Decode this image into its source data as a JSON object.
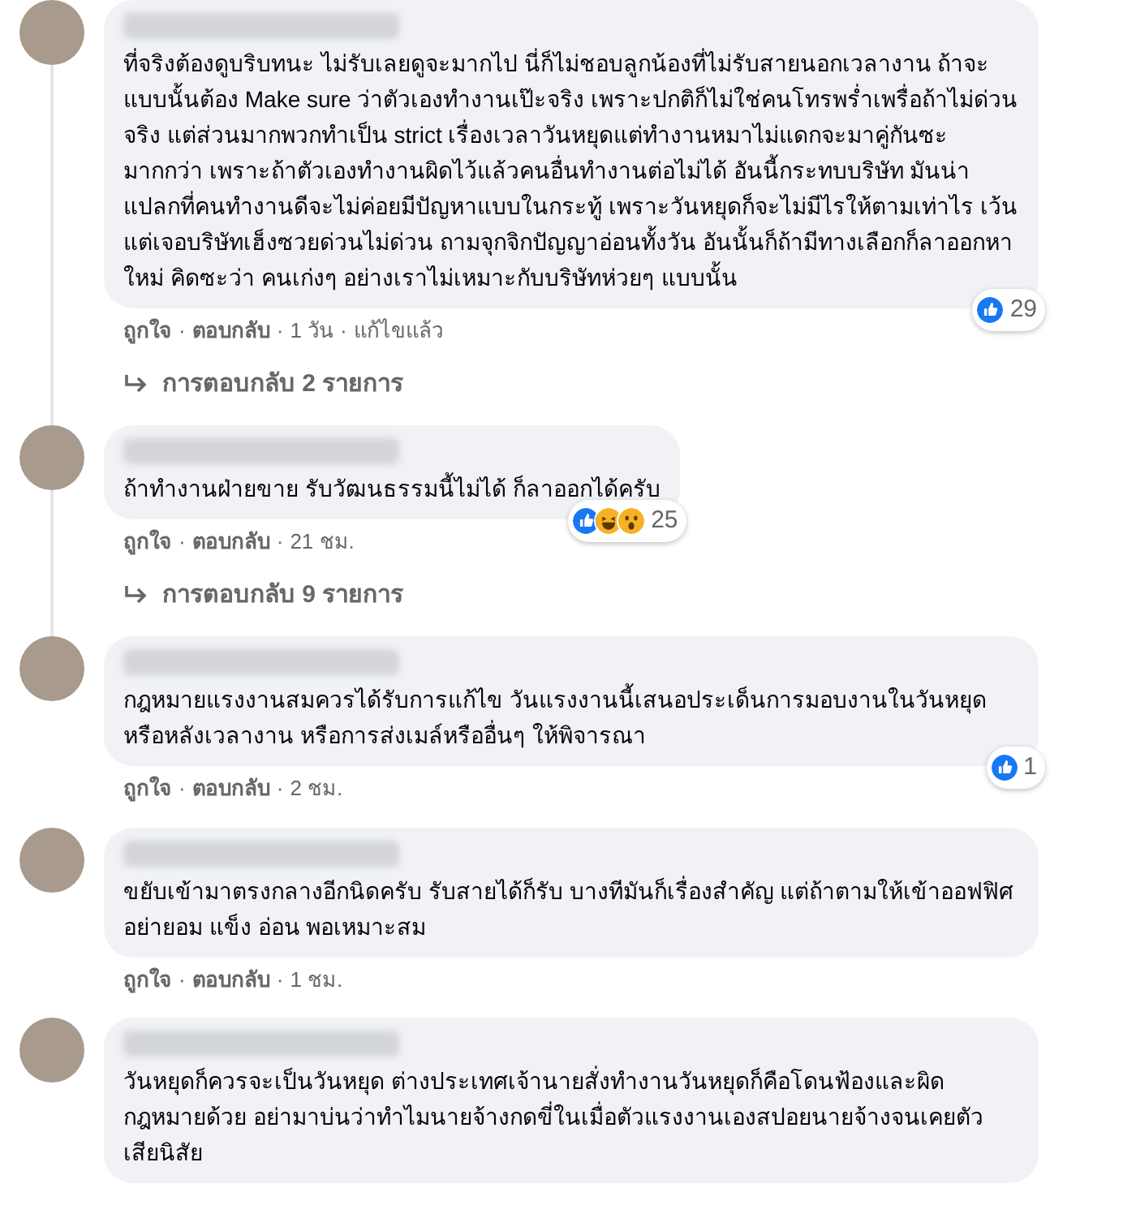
{
  "separator": "·",
  "comments": [
    {
      "text": "ที่จริงต้องดูบริบทนะ ไม่รับเลยดูจะมากไป นี่ก็ไม่ชอบลูกน้องที่ไม่รับสายนอกเวลางาน ถ้าจะแบบนั้นต้อง Make sure ว่าตัวเองทำงานเป๊ะจริง เพราะปกติก็ไม่ใช่คนโทรพร่ำเพรื่อถ้าไม่ด่วนจริง แต่ส่วนมากพวกทำเป็น strict เรื่องเวลาวันหยุดแต่ทำงานหมาไม่แดกจะมาคู่กันซะมากกว่า เพราะถ้าตัวเองทำงานผิดไว้แล้วคนอื่นทำงานต่อไม่ได้ อันนี้กระทบบริษัท มันน่าแปลกที่คนทำงานดีจะไม่ค่อยมีปัญหาแบบในกระทู้ เพราะวันหยุดก็จะไม่มีไรให้ตามเท่าไร เว้นแต่เจอบริษัทเฮ็งซวยด่วนไม่ด่วน ถามจุกจิกปัญญาอ่อนทั้งวัน อันนั้นก็ถ้ามีทางเลือกก็ลาออกหาใหม่ คิดซะว่า คนเก่งๆ อย่างเราไม่เหมาะกับบริษัทห่วยๆ แบบนั้น",
      "actions": [
        "ถูกใจ",
        "ตอบกลับ"
      ],
      "time": "1 วัน",
      "edited": "แก้ไขแล้ว",
      "reactions": {
        "types": [
          {
            "kind": "like"
          }
        ],
        "count": "29"
      },
      "replies": "การตอบกลับ 2 รายการ"
    },
    {
      "text": "ถ้าทำงานฝ่ายขาย รับวัฒนธรรมนี้ไม่ได้ ก็ลาออกได้ครับ",
      "actions": [
        "ถูกใจ",
        "ตอบกลับ"
      ],
      "time": "21 ชม.",
      "reactions": {
        "types": [
          {
            "kind": "like"
          },
          {
            "kind": "haha"
          },
          {
            "kind": "wow"
          }
        ],
        "count": "25"
      },
      "replies": "การตอบกลับ 9 รายการ"
    },
    {
      "text": "กฎหมายแรงงานสมควรได้รับการแก้ไข วันแรงงานนี้เสนอประเด็นการมอบงานในวันหยุดหรือหลังเวลางาน หรือการส่งเมล์หรืออื่นๆ ให้พิจารณา",
      "actions": [
        "ถูกใจ",
        "ตอบกลับ"
      ],
      "time": "2 ชม.",
      "reactions": {
        "types": [
          {
            "kind": "like"
          }
        ],
        "count": "1"
      }
    },
    {
      "text": "ขยับเข้ามาตรงกลางอีกนิดครับ รับสายได้ก็รับ บางทีมันก็เรื่องสำคัญ แต่ถ้าตามให้เข้าออฟฟิศอย่ายอม แข็ง อ่อน พอเหมาะสม",
      "actions": [
        "ถูกใจ",
        "ตอบกลับ"
      ],
      "time": "1 ชม."
    },
    {
      "text": "วันหยุดก็ควรจะเป็นวันหยุด ต่างประเทศเจ้านายสั่งทำงานวันหยุดก็คือโดนฟ้องและผิดกฎหมายด้วย อย่ามาบ่นว่าทำไมนายจ้างกดขี่ในเมื่อตัวแรงงานเองสปอยนายจ้างจนเคยตัว เสียนิสัย"
    }
  ]
}
